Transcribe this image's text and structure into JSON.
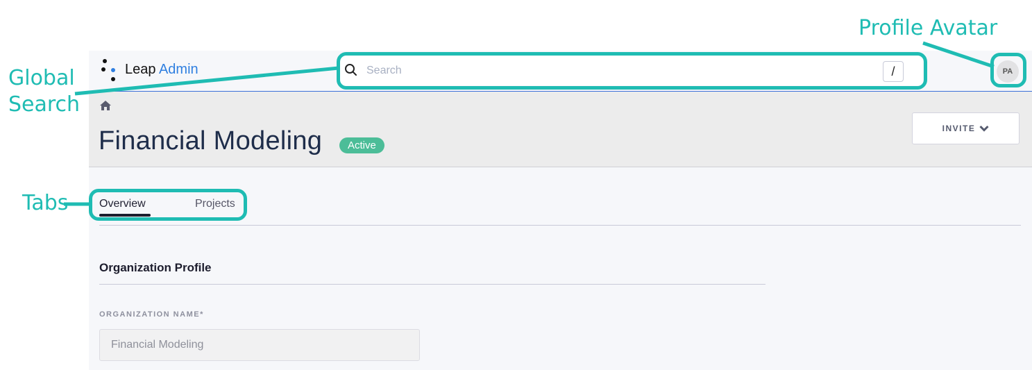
{
  "app": {
    "brand_name": "Leap",
    "brand_accent": "Admin",
    "colors": {
      "accent": "#2f7fe0",
      "status_active": "#4cbd98",
      "annotation": "#1fbcb3",
      "title": "#1e2d4a"
    }
  },
  "search": {
    "icon": "search-icon",
    "placeholder": "Search",
    "value": "",
    "shortcut_key": "/"
  },
  "profile": {
    "avatar_initials": "PA"
  },
  "header": {
    "breadcrumb_icon": "home-icon",
    "page_title": "Financial Modeling",
    "status_badge": "Active",
    "invite_label": "INVITE",
    "invite_icon": "chevron-down-icon"
  },
  "tabs": [
    {
      "label": "Overview",
      "active": true
    },
    {
      "label": "Projects",
      "active": false
    }
  ],
  "section": {
    "title": "Organization Profile",
    "fields": [
      {
        "label": "ORGANIZATION NAME*",
        "value": "Financial Modeling"
      }
    ]
  },
  "annotations": {
    "global_search": [
      "Global",
      "Search"
    ],
    "profile_avatar": "Profile Avatar",
    "tabs": "Tabs"
  }
}
